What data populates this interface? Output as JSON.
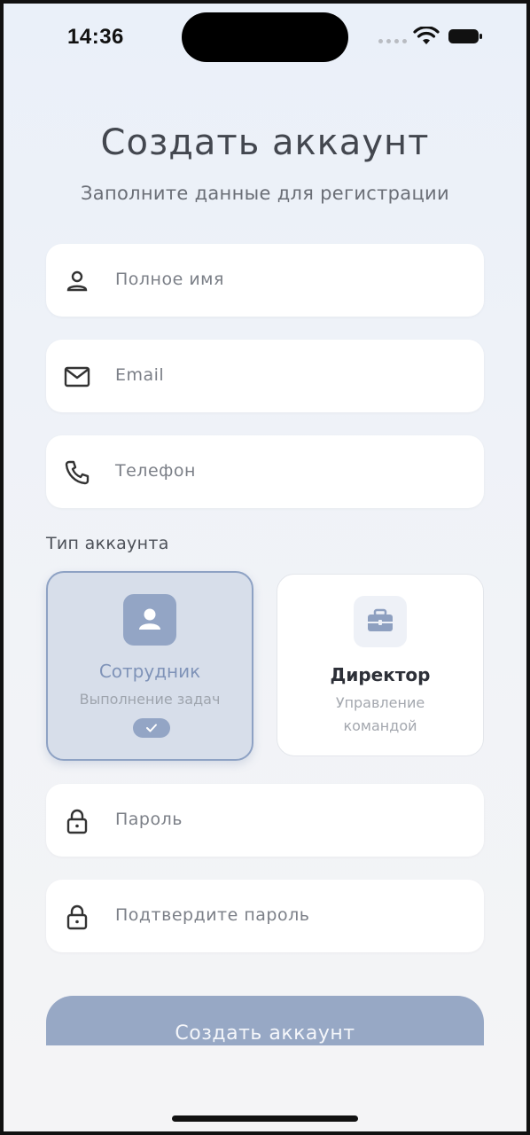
{
  "status_bar": {
    "time": "14:36"
  },
  "header": {
    "title": "Создать аккаунт",
    "subtitle": "Заполните данные для регистрации"
  },
  "fields": {
    "full_name": {
      "placeholder": "Полное имя",
      "icon": "user-icon"
    },
    "email": {
      "placeholder": "Email",
      "icon": "mail-icon"
    },
    "phone": {
      "placeholder": "Телефон",
      "icon": "phone-icon"
    },
    "password": {
      "placeholder": "Пароль",
      "icon": "lock-icon"
    },
    "confirm_password": {
      "placeholder": "Подтвердите пароль",
      "icon": "lock-icon"
    }
  },
  "account_type": {
    "label": "Тип аккаунта",
    "options": [
      {
        "name": "Сотрудник",
        "description": "Выполнение задач",
        "icon": "person-icon",
        "selected": true
      },
      {
        "name": "Директор",
        "description": "Управление командой",
        "icon": "briefcase-icon",
        "selected": false
      }
    ]
  },
  "submit": {
    "label": "Создать аккаунт"
  },
  "colors": {
    "accent": "#93a5c5",
    "selected_card_bg": "#d7deea",
    "title_text": "#43474f",
    "placeholder_text": "#7b7f87"
  }
}
